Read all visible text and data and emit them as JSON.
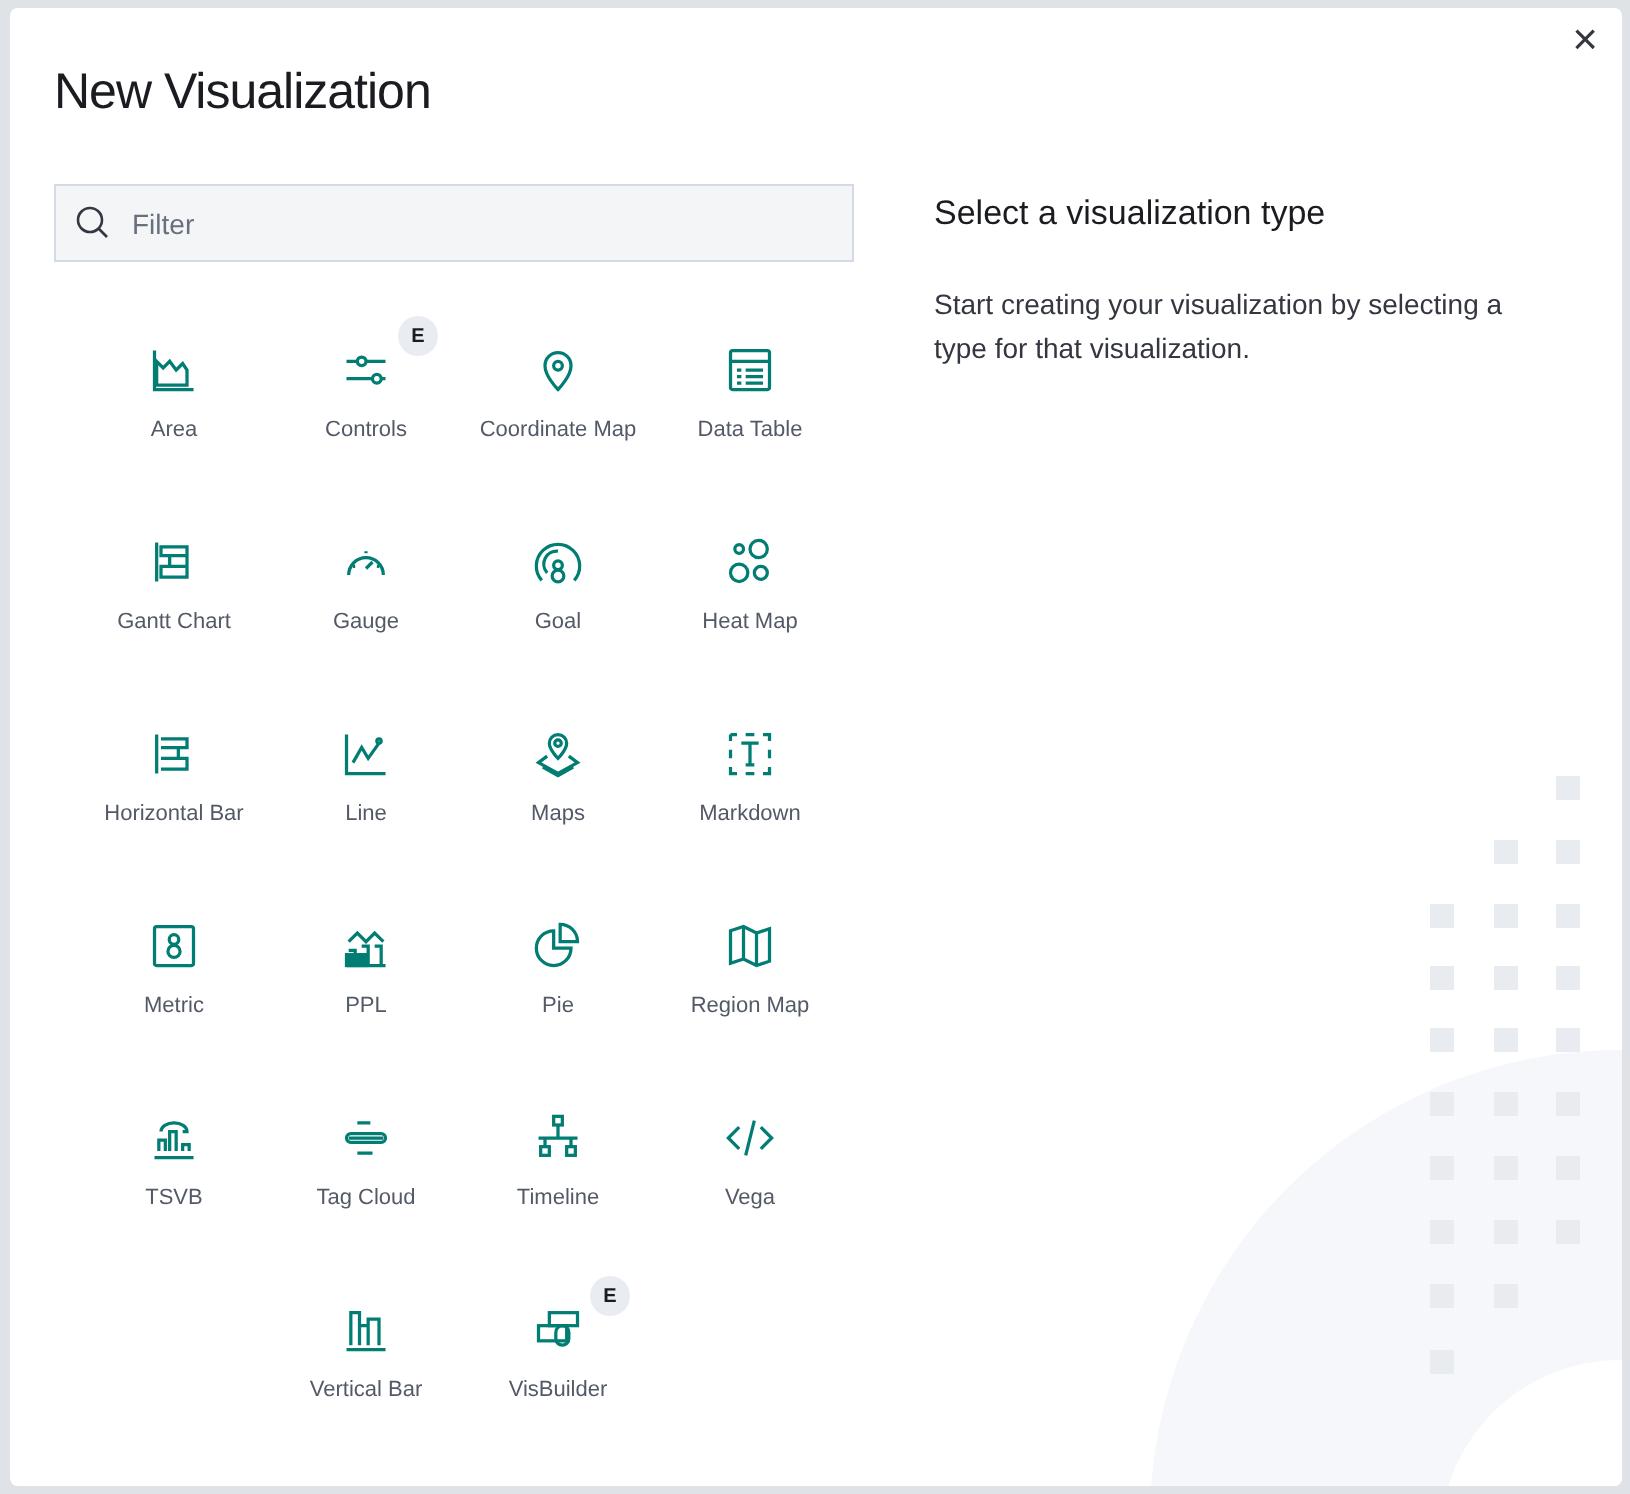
{
  "dialog": {
    "title": "New Visualization",
    "close": "×"
  },
  "search": {
    "placeholder": "Filter"
  },
  "types": [
    {
      "label": "Area"
    },
    {
      "label": "Controls",
      "badge": "E"
    },
    {
      "label": "Coordinate Map"
    },
    {
      "label": "Data Table"
    },
    {
      "label": "Gantt Chart"
    },
    {
      "label": "Gauge"
    },
    {
      "label": "Goal"
    },
    {
      "label": "Heat Map"
    },
    {
      "label": "Horizontal Bar"
    },
    {
      "label": "Line"
    },
    {
      "label": "Maps"
    },
    {
      "label": "Markdown"
    },
    {
      "label": "Metric"
    },
    {
      "label": "PPL"
    },
    {
      "label": "Pie"
    },
    {
      "label": "Region Map"
    },
    {
      "label": "TSVB"
    },
    {
      "label": "Tag Cloud"
    },
    {
      "label": "Timeline"
    },
    {
      "label": "Vega"
    },
    {
      "label": "Vertical Bar"
    },
    {
      "label": "VisBuilder",
      "badge": "E"
    }
  ],
  "info": {
    "heading": "Select a visualization type",
    "description": "Start creating your visualization by selecting a type for that visualization."
  }
}
